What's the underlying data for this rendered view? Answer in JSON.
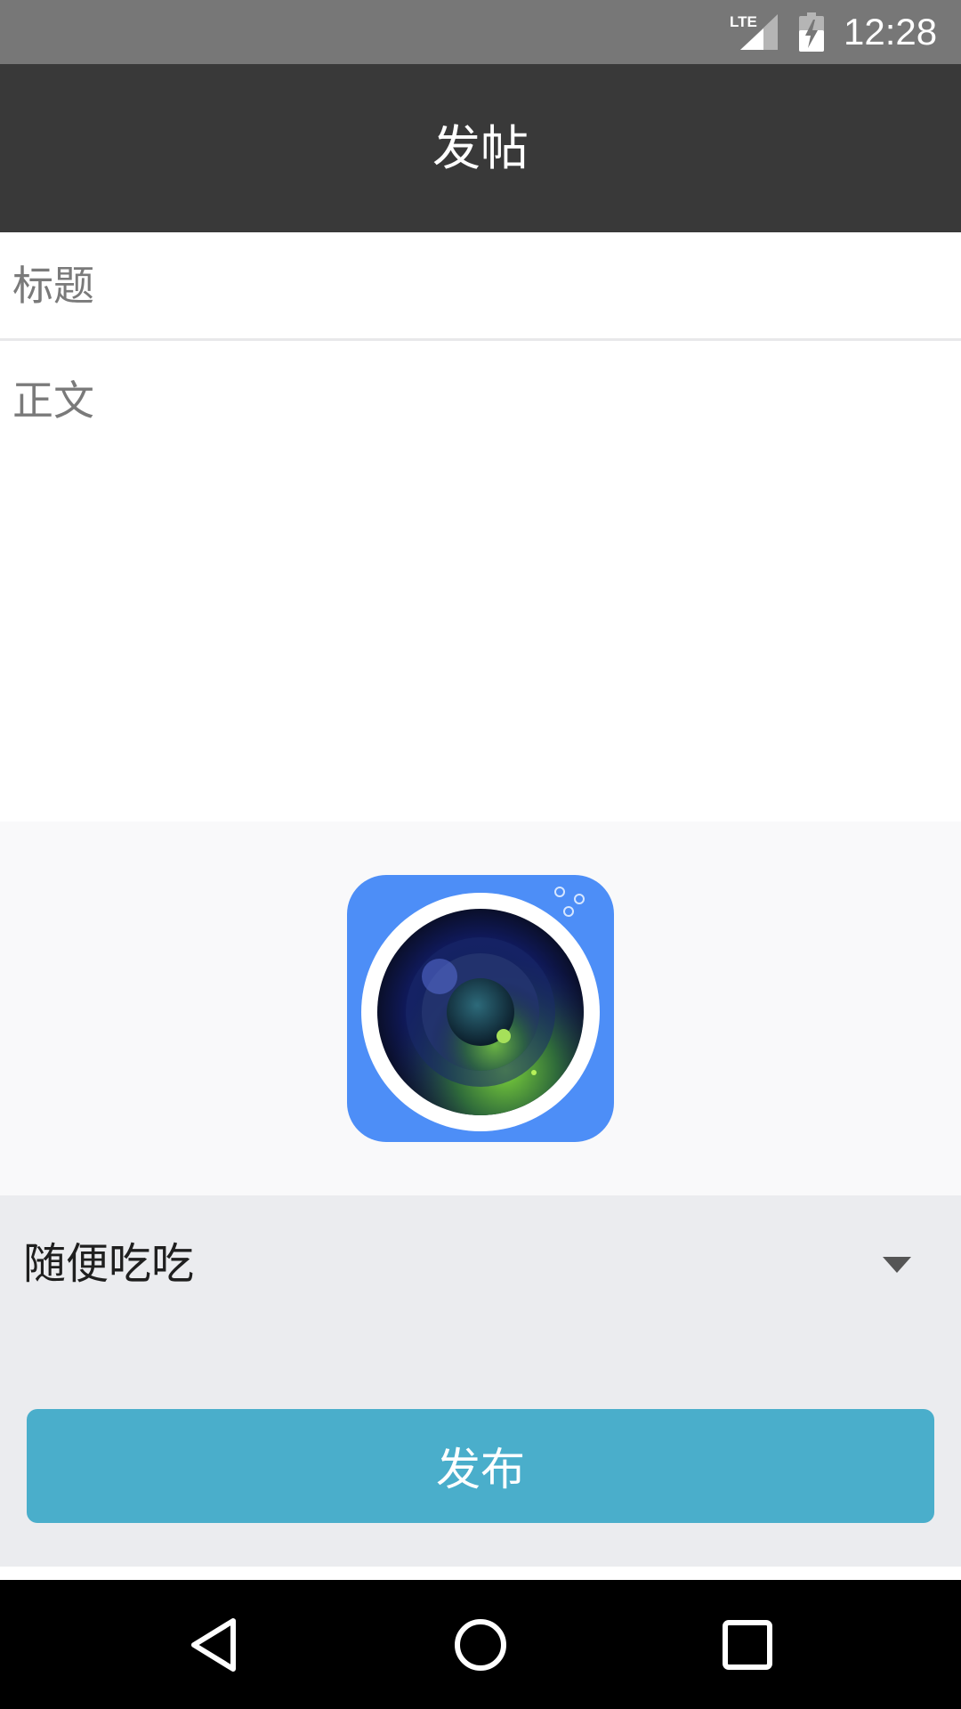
{
  "status_bar": {
    "network": "LTE",
    "time": "12:28"
  },
  "app_bar": {
    "title": "发帖"
  },
  "form": {
    "title_placeholder": "标题",
    "title_value": "",
    "body_placeholder": "正文",
    "body_value": "",
    "image_picker_icon": "camera-lens-icon",
    "category": {
      "selected": "随便吃吃",
      "icon": "dropdown-arrow-icon"
    },
    "publish_label": "发布"
  },
  "nav_bar": {
    "back_icon": "back-triangle-icon",
    "home_icon": "home-circle-icon",
    "recents_icon": "recents-square-icon"
  },
  "colors": {
    "status_bar": "#777777",
    "app_bar": "#393939",
    "accent_button": "#4aaecb",
    "camera_bg": "#4d8ef7",
    "bottom_panel": "#ebecef",
    "image_panel": "#f9f9fa"
  }
}
